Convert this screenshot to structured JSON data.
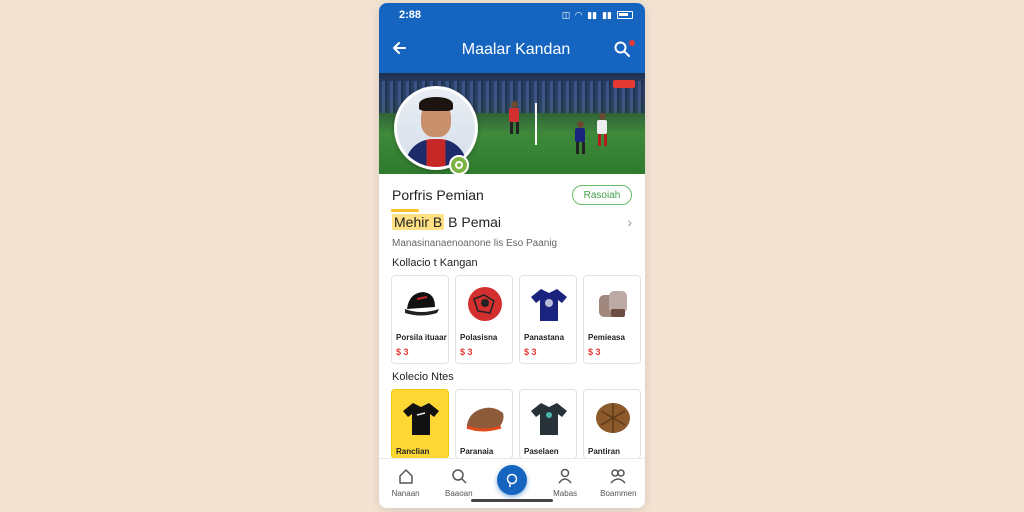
{
  "status": {
    "time": "2:88"
  },
  "appbar": {
    "title": "Maalar Kandan",
    "back_icon": "arrow-left-icon",
    "search_icon": "search-icon"
  },
  "profile": {
    "section_title": "Porfris Pemian",
    "follow_label": "Rasoiah",
    "name_highlight": "Mehir B",
    "name_rest": " B Pemai",
    "subtitle": "Manasinanaenoanone lis Eso Paanig"
  },
  "collection1": {
    "title": "Kollacio t Kangan",
    "items": [
      {
        "label": "Porsila ituaar",
        "price": "$ 3",
        "icon": "cap-icon"
      },
      {
        "label": "Polasisna",
        "price": "$ 3",
        "icon": "ball-icon"
      },
      {
        "label": "Panastana",
        "price": "$ 3",
        "icon": "shirt-icon"
      },
      {
        "label": "Pemieasa",
        "price": "$ 3",
        "icon": "gloves-icon"
      }
    ]
  },
  "collection2": {
    "title": "Kolecio Ntes",
    "items": [
      {
        "label": "Ranclian",
        "icon": "shirt-icon",
        "highlight": true
      },
      {
        "label": "Paranaia",
        "icon": "shoe-icon"
      },
      {
        "label": "Paselaen",
        "icon": "jersey-icon"
      },
      {
        "label": "Pantiran",
        "icon": "ball-icon"
      }
    ]
  },
  "nav": {
    "items": [
      {
        "label": "Nanaan",
        "icon": "home-icon"
      },
      {
        "label": "Baaoan",
        "icon": "search-icon"
      },
      {
        "label": "",
        "icon": "profile-icon",
        "active": true
      },
      {
        "label": "Mabas",
        "icon": "user-icon"
      },
      {
        "label": "Boammen",
        "icon": "group-icon"
      }
    ]
  },
  "colors": {
    "primary": "#1565c0",
    "accent": "#43a047",
    "highlight": "#ffe082",
    "price": "#e53935"
  }
}
